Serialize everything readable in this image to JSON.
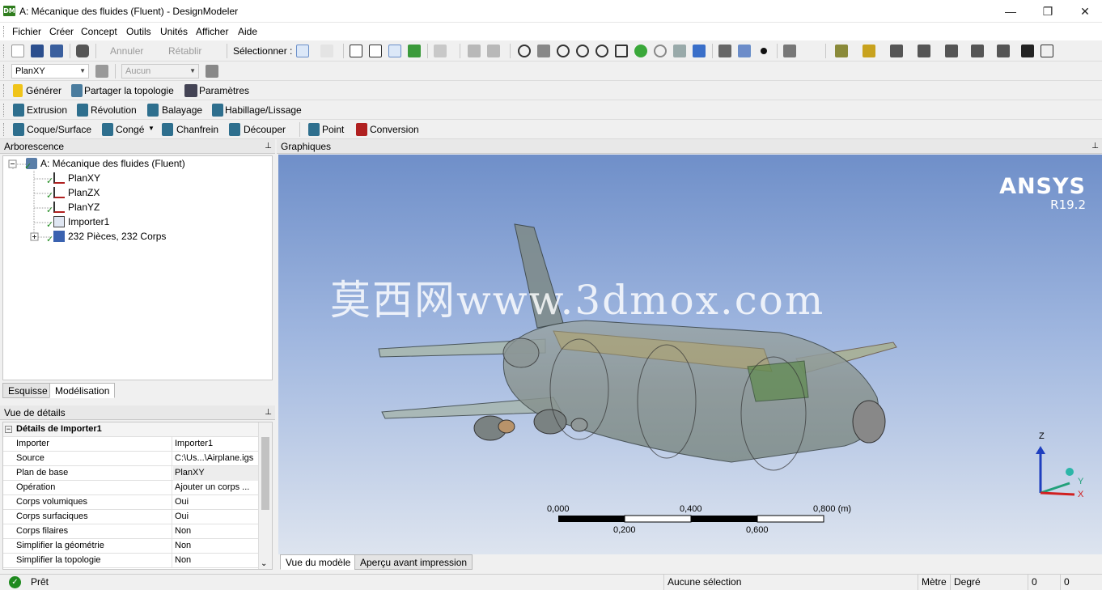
{
  "window": {
    "app_icon_text": "DM",
    "title": "A: Mécanique des fluides (Fluent) - DesignModeler",
    "minimize": "—",
    "maximize": "❐",
    "close": "✕"
  },
  "menu": [
    "Fichier",
    "Créer",
    "Concept",
    "Outils",
    "Unités",
    "Afficher",
    "Aide"
  ],
  "toolbar1": {
    "undo": "Annuler",
    "redo": "Rétablir",
    "select_label": "Sélectionner :"
  },
  "toolbar2": {
    "plane_combo": "PlanXY",
    "sketch_combo": "Aucun"
  },
  "toolbar3": {
    "generate": "Générer",
    "share_topology": "Partager la topologie",
    "parameters": "Paramètres"
  },
  "toolbar4": {
    "extrude": "Extrusion",
    "revolve": "Révolution",
    "sweep": "Balayage",
    "skin": "Habillage/Lissage"
  },
  "toolbar5": {
    "shell": "Coque/Surface",
    "blend": "Congé",
    "chamfer": "Chanfrein",
    "slice": "Découper",
    "point": "Point",
    "conversion": "Conversion"
  },
  "tree_panel": {
    "title": "Arborescence",
    "pin": "⊥",
    "root": "A: Mécanique des fluides (Fluent)",
    "items": [
      "PlanXY",
      "PlanZX",
      "PlanYZ",
      "Importer1",
      "232 Pièces, 232 Corps"
    ],
    "tabs": [
      "Esquisse",
      "Modélisation"
    ]
  },
  "details_panel": {
    "title": "Vue de détails",
    "pin": "⊥",
    "group": "Détails de Importer1",
    "rows": [
      {
        "key": "Importer",
        "value": "Importer1"
      },
      {
        "key": "Source",
        "value": "C:\\Us...\\Airplane.igs"
      },
      {
        "key": "Plan de base",
        "value": "PlanXY"
      },
      {
        "key": "Opération",
        "value": "Ajouter un corps ..."
      },
      {
        "key": "Corps volumiques",
        "value": "Oui"
      },
      {
        "key": "Corps surfaciques",
        "value": "Oui"
      },
      {
        "key": "Corps filaires",
        "value": "Non"
      },
      {
        "key": "Simplifier la géométrie",
        "value": "Non"
      },
      {
        "key": "Simplifier la topologie",
        "value": "Non"
      }
    ]
  },
  "graphics": {
    "title": "Graphiques",
    "pin": "⊥",
    "brand": "ANSYS",
    "version": "R19.2",
    "watermark": "莫西网www.3dmox.com",
    "scale_top": [
      "0,000",
      "0,400",
      "0,800 (m)"
    ],
    "scale_bottom": [
      "0,200",
      "0,600"
    ],
    "axes": {
      "z": "Z",
      "y": "Y",
      "x": "X"
    },
    "colors": {
      "bg_top": "#6f8fc9",
      "bg_bottom": "#dde4ef",
      "axis_z": "#1f3fbf",
      "axis_y": "#22a07a",
      "axis_x": "#d02020"
    }
  },
  "bottom_tabs": [
    "Vue du modèle",
    "Aperçu avant impression"
  ],
  "status": {
    "ready": "Prêt",
    "selection": "Aucune sélection",
    "length_unit": "Mètre",
    "angle_unit": "Degré",
    "v1": "0",
    "v2": "0"
  }
}
